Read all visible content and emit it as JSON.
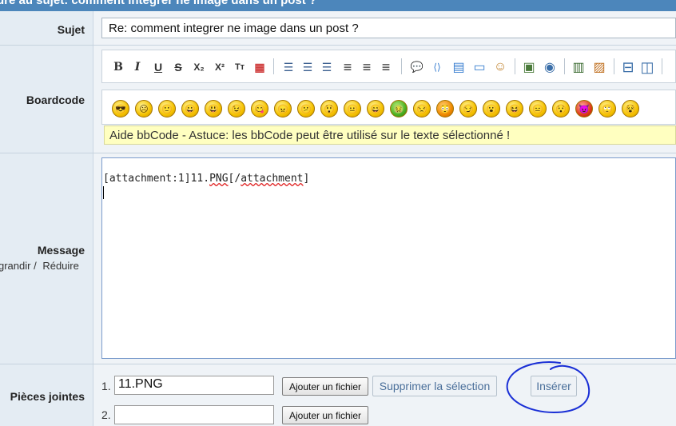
{
  "header": {
    "title": "dre au sujet: comment integrer ne image dans un post ?"
  },
  "subject": {
    "label": "Sujet",
    "value": "Re: comment integrer ne image dans un post ?"
  },
  "boardcode": {
    "label": "Boardcode",
    "format_buttons": [
      {
        "icon": "bold-icon",
        "glyph": "B"
      },
      {
        "icon": "italic-icon",
        "glyph": "I"
      },
      {
        "icon": "underline-icon",
        "glyph": "U"
      },
      {
        "icon": "strikethrough-icon",
        "glyph": "S"
      },
      {
        "icon": "subscript-icon",
        "glyph": "X₂"
      },
      {
        "icon": "superscript-icon",
        "glyph": "X²"
      },
      {
        "icon": "font-size-icon",
        "glyph": "Tт"
      },
      {
        "icon": "color-grid-icon",
        "glyph": "▦"
      }
    ],
    "align_buttons": [
      {
        "icon": "unordered-list-icon",
        "glyph": "☰"
      },
      {
        "icon": "ordered-list-icon",
        "glyph": "☰"
      },
      {
        "icon": "list-icon",
        "glyph": "☰"
      },
      {
        "icon": "align-left-icon",
        "glyph": "≡"
      },
      {
        "icon": "align-center-icon",
        "glyph": "≡"
      },
      {
        "icon": "align-right-icon",
        "glyph": "≡"
      }
    ],
    "insert_buttons": [
      {
        "icon": "quote-icon",
        "glyph": "💬"
      },
      {
        "icon": "code-icon",
        "glyph": "⟨⟩"
      },
      {
        "icon": "table-icon",
        "glyph": "▤"
      },
      {
        "icon": "window-icon",
        "glyph": "▭"
      },
      {
        "icon": "users-icon",
        "glyph": "☺"
      }
    ],
    "media_buttons": [
      {
        "icon": "image-icon",
        "glyph": "▣"
      },
      {
        "icon": "link-icon",
        "glyph": "◉"
      },
      {
        "icon": "film-icon",
        "glyph": "▥"
      },
      {
        "icon": "picture-icon",
        "glyph": "▨"
      },
      {
        "icon": "split-horizontal-icon",
        "glyph": "⊟"
      },
      {
        "icon": "split-vertical-icon",
        "glyph": "◫"
      }
    ],
    "smileys": [
      "😎",
      "☹",
      "🙂",
      "😀",
      "😃",
      "😉",
      "😋",
      "😠",
      "😕",
      "😲",
      "😐",
      "😄",
      "🤢",
      "😒",
      "😳",
      "😏",
      "😮",
      "😆",
      "😑",
      "😯",
      "😈",
      "🙄",
      "😵"
    ],
    "help_text": "Aide bbCode - Astuce: les bbCode peut être utilisé sur le texte sélectionné !"
  },
  "message": {
    "label": "Message",
    "resize_enlarge": "grandir /",
    "resize_reduce": "Réduire",
    "content_prefix": "[attachment:1]11.",
    "content_spell": "PNG",
    "content_mid": "[/",
    "content_spell2": "attachment",
    "content_suffix": "]"
  },
  "attachments": {
    "label": "Pièces jointes",
    "files": [
      {
        "num": "1.",
        "value": "11.PNG"
      },
      {
        "num": "2.",
        "value": ""
      }
    ],
    "add_label": "Ajouter un fichier",
    "remove_label": "Supprimer la sélection",
    "insert_label": "Insérer"
  },
  "colors": {
    "header": "#4c86bb",
    "annotation": "#1a2fd6"
  }
}
